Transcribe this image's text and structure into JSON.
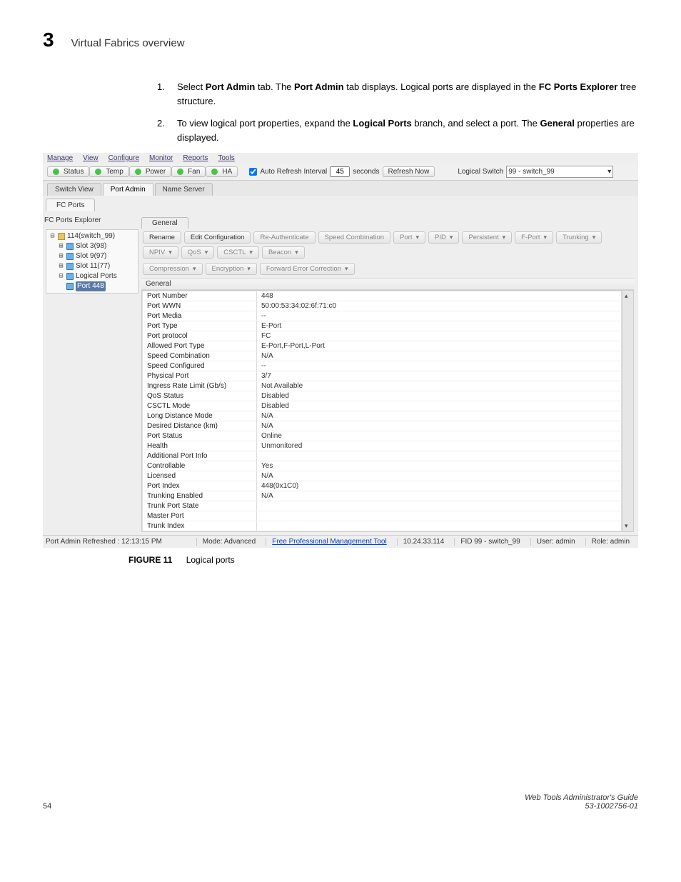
{
  "header": {
    "chapter_number": "3",
    "chapter_title": "Virtual Fabrics overview"
  },
  "steps": [
    {
      "num": "1.",
      "html": "Select <b>Port Admin</b> tab. The <b>Port Admin</b> tab displays. Logical ports are displayed in the <b>FC Ports Explorer</b> tree structure."
    },
    {
      "num": "2.",
      "html": "To view logical port properties, expand the <b>Logical Ports</b> branch, and select a port. The <b>General</b> properties are displayed."
    }
  ],
  "menus": [
    "Manage",
    "View",
    "Configure",
    "Monitor",
    "Reports",
    "Tools"
  ],
  "status": {
    "buttons": [
      "Status",
      "Temp",
      "Power",
      "Fan",
      "HA"
    ],
    "auto_refresh_label": "Auto Refresh Interval",
    "auto_refresh_value": "45",
    "seconds": "seconds",
    "refresh_now": "Refresh Now",
    "logical_switch_label": "Logical Switch",
    "logical_switch_value": "99 - switch_99"
  },
  "top_tabs": {
    "switch_view": "Switch View",
    "port_admin": "Port Admin",
    "name_server": "Name Server"
  },
  "fc_ports_tab": "FC Ports",
  "explorer": {
    "title": "FC Ports Explorer",
    "root": "114(switch_99)",
    "slots": [
      "Slot 3(98)",
      "Slot 9(97)",
      "Slot 11(77)"
    ],
    "logical_ports": "Logical Ports",
    "selected": "Port 448"
  },
  "general_tab": "General",
  "tool_buttons_row1": [
    "Rename",
    "Edit Configuration",
    "Re-Authenticate",
    "Speed Combination",
    "Port",
    "PID",
    "Persistent",
    "F-Port",
    "Trunking",
    "NPIV",
    "QoS",
    "CSCTL",
    "Beacon"
  ],
  "tool_buttons_row2": [
    "Compression",
    "Encryption",
    "Forward Error Correction"
  ],
  "section_label": "General",
  "properties": [
    [
      "Port Number",
      "448"
    ],
    [
      "Port WWN",
      "50:00:53:34:02:6f:71:c0"
    ],
    [
      "Port Media",
      "--"
    ],
    [
      "Port Type",
      "E-Port"
    ],
    [
      "Port protocol",
      "FC"
    ],
    [
      "Allowed Port Type",
      "E-Port,F-Port,L-Port"
    ],
    [
      "Speed Combination",
      "N/A"
    ],
    [
      "Speed Configured",
      "--"
    ],
    [
      "Physical Port",
      "3/7"
    ],
    [
      "Ingress Rate Limit (Gb/s)",
      "Not Available"
    ],
    [
      "QoS Status",
      "Disabled"
    ],
    [
      "CSCTL Mode",
      "Disabled"
    ],
    [
      "Long Distance Mode",
      "N/A"
    ],
    [
      "Desired Distance (km)",
      "N/A"
    ],
    [
      "Port Status",
      "Online"
    ],
    [
      "Health",
      "Unmonitored"
    ],
    [
      "Additional Port Info",
      ""
    ],
    [
      "Controllable",
      "Yes"
    ],
    [
      "Licensed",
      "N/A"
    ],
    [
      "Port Index",
      "448(0x1C0)"
    ],
    [
      "Trunking Enabled",
      "N/A"
    ],
    [
      "Trunk Port State",
      ""
    ],
    [
      "Master Port",
      ""
    ],
    [
      "Trunk Index",
      ""
    ]
  ],
  "footer_app": {
    "refreshed": "Port Admin Refreshed : 12:13:15 PM",
    "mode": "Mode: Advanced",
    "tool_link": "Free Professional Management Tool",
    "ip": "10.24.33.114",
    "fid": "FID 99 - switch_99",
    "user": "User: admin",
    "role": "Role: admin"
  },
  "figure_caption": {
    "label": "FIGURE 11",
    "text": "Logical ports"
  },
  "page_footer": {
    "page": "54",
    "guide": "Web Tools Administrator's Guide",
    "docnum": "53-1002756-01"
  }
}
